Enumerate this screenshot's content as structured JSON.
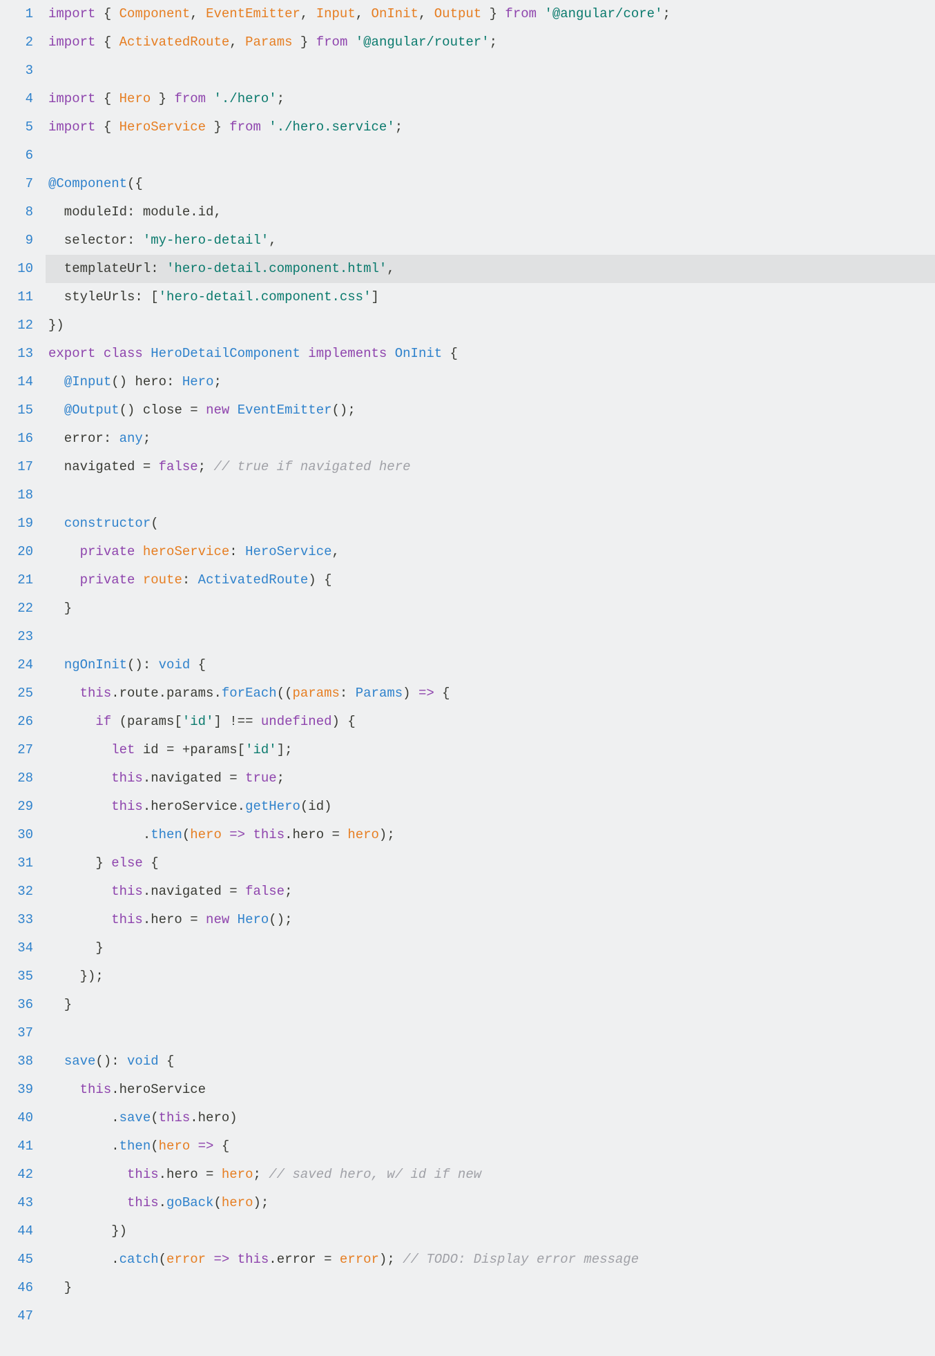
{
  "lines": [
    {
      "n": 1,
      "t": [
        [
          "kw",
          "import"
        ],
        [
          "plain",
          " { "
        ],
        [
          "decl",
          "Component"
        ],
        [
          "plain",
          ", "
        ],
        [
          "decl",
          "EventEmitter"
        ],
        [
          "plain",
          ", "
        ],
        [
          "decl",
          "Input"
        ],
        [
          "plain",
          ", "
        ],
        [
          "decl",
          "OnInit"
        ],
        [
          "plain",
          ", "
        ],
        [
          "decl",
          "Output"
        ],
        [
          "plain",
          " } "
        ],
        [
          "kw",
          "from"
        ],
        [
          "plain",
          " "
        ],
        [
          "str",
          "'@angular/core'"
        ],
        [
          "plain",
          ";"
        ]
      ]
    },
    {
      "n": 2,
      "t": [
        [
          "kw",
          "import"
        ],
        [
          "plain",
          " { "
        ],
        [
          "decl",
          "ActivatedRoute"
        ],
        [
          "plain",
          ", "
        ],
        [
          "decl",
          "Params"
        ],
        [
          "plain",
          " } "
        ],
        [
          "kw",
          "from"
        ],
        [
          "plain",
          " "
        ],
        [
          "str",
          "'@angular/router'"
        ],
        [
          "plain",
          ";"
        ]
      ]
    },
    {
      "n": 3,
      "t": []
    },
    {
      "n": 4,
      "t": [
        [
          "kw",
          "import"
        ],
        [
          "plain",
          " { "
        ],
        [
          "decl",
          "Hero"
        ],
        [
          "plain",
          " } "
        ],
        [
          "kw",
          "from"
        ],
        [
          "plain",
          " "
        ],
        [
          "str",
          "'./hero'"
        ],
        [
          "plain",
          ";"
        ]
      ]
    },
    {
      "n": 5,
      "t": [
        [
          "kw",
          "import"
        ],
        [
          "plain",
          " { "
        ],
        [
          "decl",
          "HeroService"
        ],
        [
          "plain",
          " } "
        ],
        [
          "kw",
          "from"
        ],
        [
          "plain",
          " "
        ],
        [
          "str",
          "'./hero.service'"
        ],
        [
          "plain",
          ";"
        ]
      ]
    },
    {
      "n": 6,
      "t": []
    },
    {
      "n": 7,
      "t": [
        [
          "deco",
          "@Component"
        ],
        [
          "plain",
          "({"
        ]
      ]
    },
    {
      "n": 8,
      "t": [
        [
          "plain",
          "  moduleId: module.id,"
        ]
      ]
    },
    {
      "n": 9,
      "t": [
        [
          "plain",
          "  selector: "
        ],
        [
          "str",
          "'my-hero-detail'"
        ],
        [
          "plain",
          ","
        ]
      ]
    },
    {
      "n": 10,
      "hl": true,
      "t": [
        [
          "plain",
          "  templateUrl: "
        ],
        [
          "str",
          "'hero-detail.component.html'"
        ],
        [
          "plain",
          ","
        ]
      ]
    },
    {
      "n": 11,
      "t": [
        [
          "plain",
          "  styleUrls: ["
        ],
        [
          "str",
          "'hero-detail.component.css'"
        ],
        [
          "plain",
          "]"
        ]
      ]
    },
    {
      "n": 12,
      "t": [
        [
          "plain",
          "})"
        ]
      ]
    },
    {
      "n": 13,
      "t": [
        [
          "kw",
          "export"
        ],
        [
          "plain",
          " "
        ],
        [
          "kw",
          "class"
        ],
        [
          "plain",
          " "
        ],
        [
          "type",
          "HeroDetailComponent"
        ],
        [
          "plain",
          " "
        ],
        [
          "kw",
          "implements"
        ],
        [
          "plain",
          " "
        ],
        [
          "type",
          "OnInit"
        ],
        [
          "plain",
          " {"
        ]
      ]
    },
    {
      "n": 14,
      "t": [
        [
          "plain",
          "  "
        ],
        [
          "deco",
          "@Input"
        ],
        [
          "plain",
          "() hero: "
        ],
        [
          "type",
          "Hero"
        ],
        [
          "plain",
          ";"
        ]
      ]
    },
    {
      "n": 15,
      "t": [
        [
          "plain",
          "  "
        ],
        [
          "deco",
          "@Output"
        ],
        [
          "plain",
          "() close = "
        ],
        [
          "kw",
          "new"
        ],
        [
          "plain",
          " "
        ],
        [
          "type",
          "EventEmitter"
        ],
        [
          "plain",
          "();"
        ]
      ]
    },
    {
      "n": 16,
      "t": [
        [
          "plain",
          "  error: "
        ],
        [
          "type",
          "any"
        ],
        [
          "plain",
          ";"
        ]
      ]
    },
    {
      "n": 17,
      "t": [
        [
          "plain",
          "  navigated = "
        ],
        [
          "bool",
          "false"
        ],
        [
          "plain",
          "; "
        ],
        [
          "cmt",
          "// true if navigated here"
        ]
      ]
    },
    {
      "n": 18,
      "t": []
    },
    {
      "n": 19,
      "t": [
        [
          "plain",
          "  "
        ],
        [
          "fn",
          "constructor"
        ],
        [
          "plain",
          "("
        ]
      ]
    },
    {
      "n": 20,
      "t": [
        [
          "plain",
          "    "
        ],
        [
          "kw",
          "private"
        ],
        [
          "plain",
          " "
        ],
        [
          "decl",
          "heroService"
        ],
        [
          "plain",
          ": "
        ],
        [
          "type",
          "HeroService"
        ],
        [
          "plain",
          ","
        ]
      ]
    },
    {
      "n": 21,
      "t": [
        [
          "plain",
          "    "
        ],
        [
          "kw",
          "private"
        ],
        [
          "plain",
          " "
        ],
        [
          "decl",
          "route"
        ],
        [
          "plain",
          ": "
        ],
        [
          "type",
          "ActivatedRoute"
        ],
        [
          "plain",
          ") {"
        ]
      ]
    },
    {
      "n": 22,
      "t": [
        [
          "plain",
          "  }"
        ]
      ]
    },
    {
      "n": 23,
      "t": []
    },
    {
      "n": 24,
      "t": [
        [
          "plain",
          "  "
        ],
        [
          "fn",
          "ngOnInit"
        ],
        [
          "plain",
          "(): "
        ],
        [
          "type",
          "void"
        ],
        [
          "plain",
          " {"
        ]
      ]
    },
    {
      "n": 25,
      "t": [
        [
          "plain",
          "    "
        ],
        [
          "this",
          "this"
        ],
        [
          "plain",
          ".route.params."
        ],
        [
          "fn",
          "forEach"
        ],
        [
          "plain",
          "(("
        ],
        [
          "param",
          "params"
        ],
        [
          "plain",
          ": "
        ],
        [
          "type",
          "Params"
        ],
        [
          "plain",
          ") "
        ],
        [
          "kw",
          "=>"
        ],
        [
          "plain",
          " {"
        ]
      ]
    },
    {
      "n": 26,
      "t": [
        [
          "plain",
          "      "
        ],
        [
          "kw",
          "if"
        ],
        [
          "plain",
          " (params["
        ],
        [
          "str",
          "'id'"
        ],
        [
          "plain",
          "] !== "
        ],
        [
          "bool",
          "undefined"
        ],
        [
          "plain",
          ") {"
        ]
      ]
    },
    {
      "n": 27,
      "t": [
        [
          "plain",
          "        "
        ],
        [
          "kw",
          "let"
        ],
        [
          "plain",
          " id = +params["
        ],
        [
          "str",
          "'id'"
        ],
        [
          "plain",
          "];"
        ]
      ]
    },
    {
      "n": 28,
      "t": [
        [
          "plain",
          "        "
        ],
        [
          "this",
          "this"
        ],
        [
          "plain",
          ".navigated = "
        ],
        [
          "bool",
          "true"
        ],
        [
          "plain",
          ";"
        ]
      ]
    },
    {
      "n": 29,
      "t": [
        [
          "plain",
          "        "
        ],
        [
          "this",
          "this"
        ],
        [
          "plain",
          ".heroService."
        ],
        [
          "fn",
          "getHero"
        ],
        [
          "plain",
          "(id)"
        ]
      ]
    },
    {
      "n": 30,
      "t": [
        [
          "plain",
          "            ."
        ],
        [
          "fn",
          "then"
        ],
        [
          "plain",
          "("
        ],
        [
          "param",
          "hero"
        ],
        [
          "plain",
          " "
        ],
        [
          "kw",
          "=>"
        ],
        [
          "plain",
          " "
        ],
        [
          "this",
          "this"
        ],
        [
          "plain",
          ".hero = "
        ],
        [
          "param",
          "hero"
        ],
        [
          "plain",
          ");"
        ]
      ]
    },
    {
      "n": 31,
      "t": [
        [
          "plain",
          "      } "
        ],
        [
          "kw",
          "else"
        ],
        [
          "plain",
          " {"
        ]
      ]
    },
    {
      "n": 32,
      "t": [
        [
          "plain",
          "        "
        ],
        [
          "this",
          "this"
        ],
        [
          "plain",
          ".navigated = "
        ],
        [
          "bool",
          "false"
        ],
        [
          "plain",
          ";"
        ]
      ]
    },
    {
      "n": 33,
      "t": [
        [
          "plain",
          "        "
        ],
        [
          "this",
          "this"
        ],
        [
          "plain",
          ".hero = "
        ],
        [
          "kw",
          "new"
        ],
        [
          "plain",
          " "
        ],
        [
          "type",
          "Hero"
        ],
        [
          "plain",
          "();"
        ]
      ]
    },
    {
      "n": 34,
      "t": [
        [
          "plain",
          "      }"
        ]
      ]
    },
    {
      "n": 35,
      "t": [
        [
          "plain",
          "    });"
        ]
      ]
    },
    {
      "n": 36,
      "t": [
        [
          "plain",
          "  }"
        ]
      ]
    },
    {
      "n": 37,
      "t": []
    },
    {
      "n": 38,
      "t": [
        [
          "plain",
          "  "
        ],
        [
          "fn",
          "save"
        ],
        [
          "plain",
          "(): "
        ],
        [
          "type",
          "void"
        ],
        [
          "plain",
          " {"
        ]
      ]
    },
    {
      "n": 39,
      "t": [
        [
          "plain",
          "    "
        ],
        [
          "this",
          "this"
        ],
        [
          "plain",
          ".heroService"
        ]
      ]
    },
    {
      "n": 40,
      "t": [
        [
          "plain",
          "        ."
        ],
        [
          "fn",
          "save"
        ],
        [
          "plain",
          "("
        ],
        [
          "this",
          "this"
        ],
        [
          "plain",
          ".hero)"
        ]
      ]
    },
    {
      "n": 41,
      "t": [
        [
          "plain",
          "        ."
        ],
        [
          "fn",
          "then"
        ],
        [
          "plain",
          "("
        ],
        [
          "param",
          "hero"
        ],
        [
          "plain",
          " "
        ],
        [
          "kw",
          "=>"
        ],
        [
          "plain",
          " {"
        ]
      ]
    },
    {
      "n": 42,
      "t": [
        [
          "plain",
          "          "
        ],
        [
          "this",
          "this"
        ],
        [
          "plain",
          ".hero = "
        ],
        [
          "param",
          "hero"
        ],
        [
          "plain",
          "; "
        ],
        [
          "cmt",
          "// saved hero, w/ id if new"
        ]
      ]
    },
    {
      "n": 43,
      "t": [
        [
          "plain",
          "          "
        ],
        [
          "this",
          "this"
        ],
        [
          "plain",
          "."
        ],
        [
          "fn",
          "goBack"
        ],
        [
          "plain",
          "("
        ],
        [
          "param",
          "hero"
        ],
        [
          "plain",
          ");"
        ]
      ]
    },
    {
      "n": 44,
      "t": [
        [
          "plain",
          "        })"
        ]
      ]
    },
    {
      "n": 45,
      "t": [
        [
          "plain",
          "        ."
        ],
        [
          "fn",
          "catch"
        ],
        [
          "plain",
          "("
        ],
        [
          "param",
          "error"
        ],
        [
          "plain",
          " "
        ],
        [
          "kw",
          "=>"
        ],
        [
          "plain",
          " "
        ],
        [
          "this",
          "this"
        ],
        [
          "plain",
          ".error = "
        ],
        [
          "param",
          "error"
        ],
        [
          "plain",
          "); "
        ],
        [
          "cmt",
          "// TODO: Display error message"
        ]
      ]
    },
    {
      "n": 46,
      "t": [
        [
          "plain",
          "  }"
        ]
      ]
    },
    {
      "n": 47,
      "t": []
    }
  ]
}
